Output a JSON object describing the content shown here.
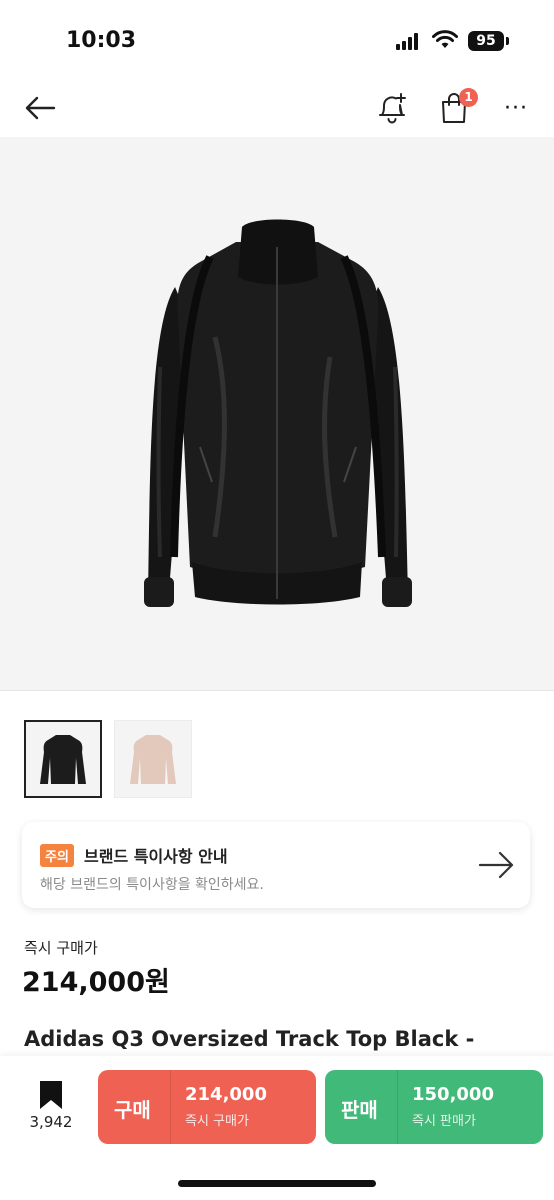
{
  "status_bar": {
    "time": "10:03",
    "battery": "95"
  },
  "nav": {
    "cart_count": "1",
    "more": "···"
  },
  "notice": {
    "tag": "주의",
    "title": "브랜드 특이사항 안내",
    "description": "해당 브랜드의 특이사항을 확인하세요."
  },
  "price": {
    "label": "즉시 구매가",
    "value": "214,000원"
  },
  "product": {
    "name": "Adidas Q3 Oversized Track Top Black -"
  },
  "bottom": {
    "wish_count": "3,942",
    "buy": {
      "label": "구매",
      "price": "214,000",
      "sub": "즉시 구매가"
    },
    "sell": {
      "label": "판매",
      "price": "150,000",
      "sub": "즉시 판매가"
    }
  },
  "colors": {
    "buy": "#ef6253",
    "sell": "#41b979",
    "notice_tag": "#f3833f"
  }
}
